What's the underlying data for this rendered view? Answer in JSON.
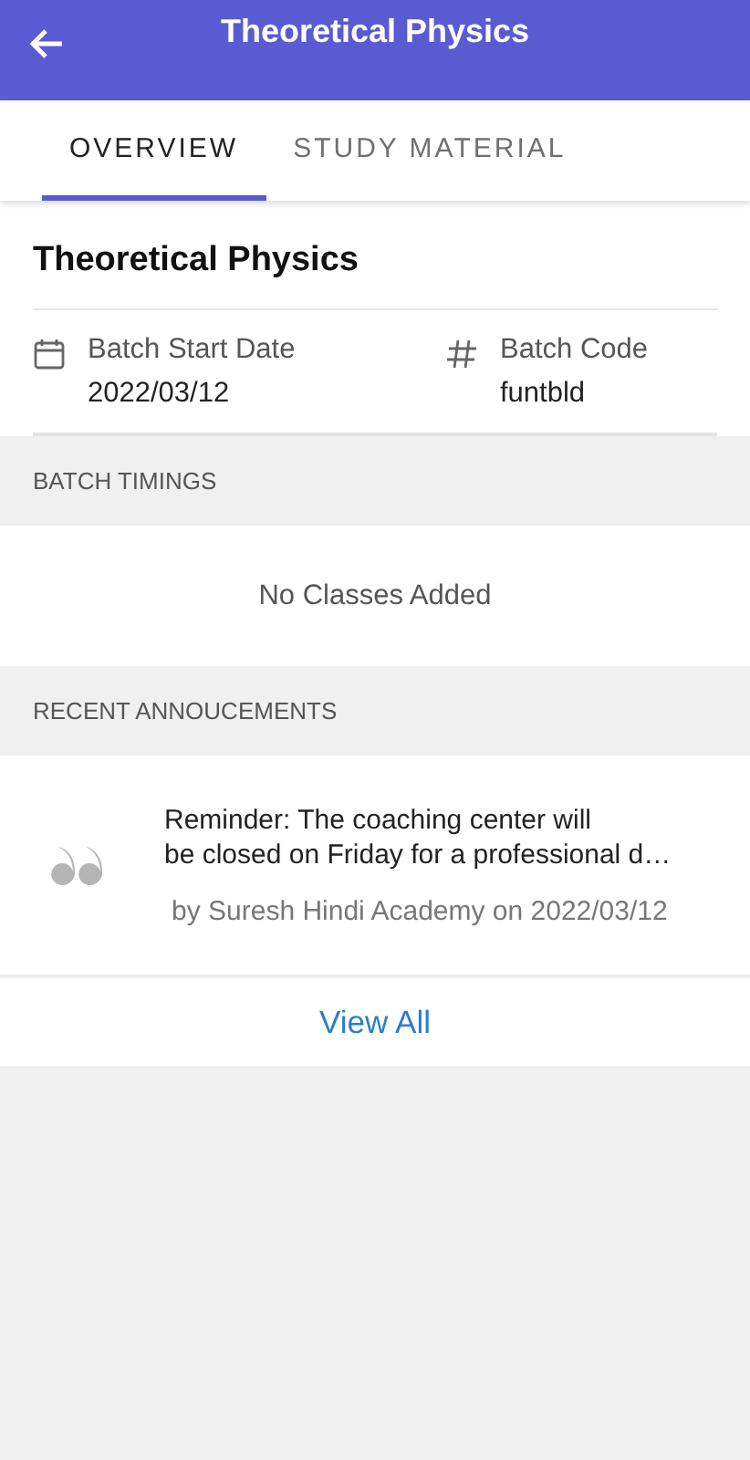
{
  "app_bar": {
    "title": "Theoretical Physics"
  },
  "tabs": [
    {
      "label": "OVERVIEW",
      "selected": true
    },
    {
      "label": "STUDY MATERIAL",
      "selected": false
    }
  ],
  "batch": {
    "name": "Theoretical Physics",
    "details": [
      {
        "kind": "calendar",
        "label": "Batch Start Date",
        "value": "2022/03/12"
      },
      {
        "kind": "hash",
        "label": "Batch Code",
        "value": "funtbld"
      }
    ]
  },
  "batch_timings": {
    "heading": "BATCH TIMINGS",
    "empty_text": "No Classes Added"
  },
  "announcements": {
    "heading": "RECENT ANNOUCEMENTS",
    "items": [
      {
        "lines": [
          "Reminder: The coaching center will",
          "be closed on Friday for a professional d…"
        ],
        "byline": "by Suresh Hindi Academy on 2022/03/12"
      }
    ],
    "view_all": "View All"
  }
}
